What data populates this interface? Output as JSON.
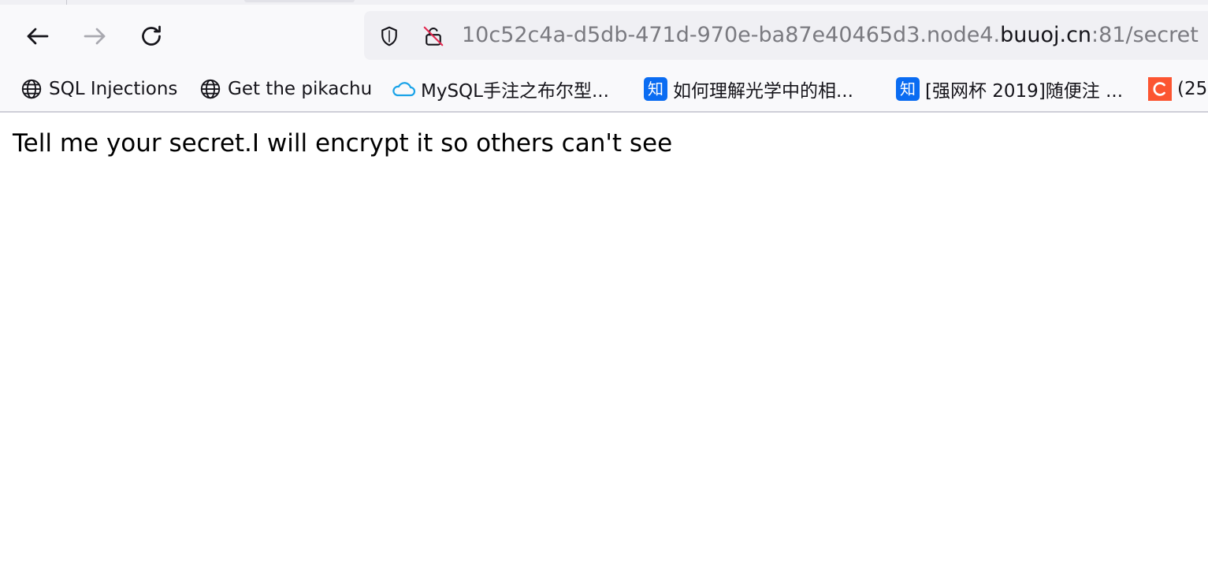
{
  "browser": {
    "colors": {
      "toolbar_bg": "#f9f9fb",
      "urlbar_bg": "#f0f0f4",
      "text": "#15141a",
      "muted_text": "#7a7a80",
      "insecure_slash": "#e22850",
      "zhihu_blue": "#0a6cf2",
      "csdn_orange": "#fc5531",
      "cloud_blue": "#1aa3e8"
    },
    "nav": {
      "back_icon": "arrow-left-icon",
      "forward_icon": "arrow-right-icon",
      "reload_icon": "reload-icon"
    },
    "urlbar": {
      "url_prefix": "10c52c4a-d5db-471d-970e-ba87e40465d3.node4.",
      "url_domain": "buuoj.cn",
      "url_suffix": ":81/secret",
      "tracking_icon": "shield-icon",
      "security_icon": "insecure-lock-icon"
    },
    "bookmarks": [
      {
        "label": "SQL Injections",
        "icon": "globe-icon"
      },
      {
        "label": "Get the pikachu",
        "icon": "globe-icon"
      },
      {
        "label": "MySQL手注之布尔型...",
        "icon": "cloud-icon"
      },
      {
        "label": "如何理解光学中的相...",
        "icon": "zhihu-icon",
        "icon_text": "知"
      },
      {
        "label": "[强网杯 2019]随便注 ...",
        "icon": "zhihu-icon",
        "icon_text": "知"
      },
      {
        "label": "(25",
        "icon": "csdn-icon"
      }
    ]
  },
  "page": {
    "body_text": "Tell me your secret.I will encrypt it so others can't see"
  }
}
